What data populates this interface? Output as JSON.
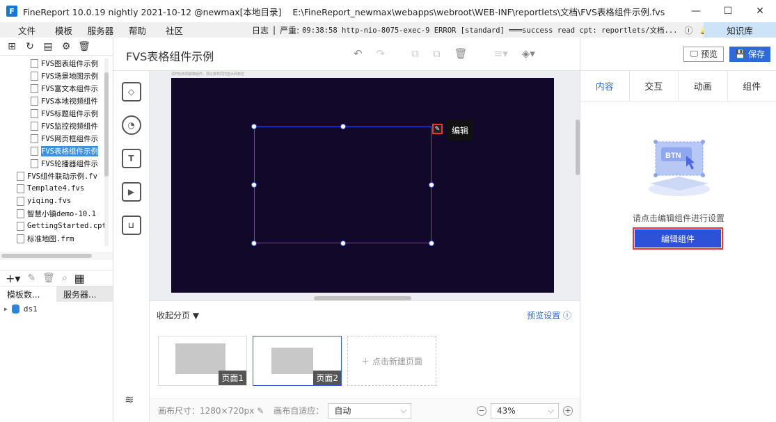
{
  "window": {
    "title": "FineReport 10.0.19 nightly 2021-10-12 @newmax[本地目录]",
    "path": "E:\\FineReport_newmax\\webapps\\webroot\\WEB-INF\\reportlets\\文档\\FVS表格组件示例.fvs",
    "minimize": "—",
    "maximize": "☐",
    "close": "✕"
  },
  "menu": [
    "文件",
    "模板",
    "服务器",
    "帮助",
    "社区"
  ],
  "log": {
    "label": "日志",
    "separator": "|",
    "level": "严重:",
    "message": "09:38:58 http-nio-8075-exec-9 ERROR [standard] ═══success read cpt: reportlets/文档...",
    "knowledge": "知识库"
  },
  "left": {
    "tree_items": [
      {
        "label": "FVS图表组件示例",
        "indent": 2,
        "selected": false
      },
      {
        "label": "FVS场景地图示例",
        "indent": 2,
        "selected": false
      },
      {
        "label": "FVS富文本组件示",
        "indent": 2,
        "selected": false
      },
      {
        "label": "FVS本地视频组件",
        "indent": 2,
        "selected": false
      },
      {
        "label": "FVS标题组件示例",
        "indent": 2,
        "selected": false
      },
      {
        "label": "FVS监控视频组件",
        "indent": 2,
        "selected": false
      },
      {
        "label": "FVS网页框组件示",
        "indent": 2,
        "selected": false
      },
      {
        "label": "FVS表格组件示例",
        "indent": 2,
        "selected": true
      },
      {
        "label": "FVS轮播器组件示",
        "indent": 2,
        "selected": false
      },
      {
        "label": "FVS组件联动示例.fv",
        "indent": 1,
        "selected": false
      },
      {
        "label": "Template4.fvs",
        "indent": 1,
        "selected": false
      },
      {
        "label": "yiqing.fvs",
        "indent": 1,
        "selected": false
      },
      {
        "label": "智慧小镇demo-10.1",
        "indent": 1,
        "selected": false
      },
      {
        "label": "GettingStarted.cpt",
        "indent": 1,
        "selected": false
      },
      {
        "label": "标准地图.frm",
        "indent": 1,
        "selected": false
      }
    ],
    "tab_templates": "模板数...",
    "tab_server": "服务器...",
    "datasource": "ds1"
  },
  "editor": {
    "title": "FVS表格组件示例",
    "canvas_hint": "请开始布局装填组件，预以放布同内容大风到位",
    "edit_tooltip": "编辑",
    "collapse_pages": "收起分页",
    "preview_settings": "预览设置",
    "pages": [
      "页面1",
      "页面2"
    ],
    "new_page": "＋ 点击新建页面",
    "canvas_size_label": "画布尺寸：",
    "canvas_size": "1280×720px",
    "adapt_label": "画布自适应：",
    "adapt_value": "自动",
    "zoom": "43%"
  },
  "right": {
    "preview": "预览",
    "save": "保存",
    "tabs": [
      "内容",
      "交互",
      "动画",
      "组件"
    ],
    "hint": "请点击编辑组件进行设置",
    "edit_component": "编辑组件",
    "illustration_text": "BTN"
  }
}
